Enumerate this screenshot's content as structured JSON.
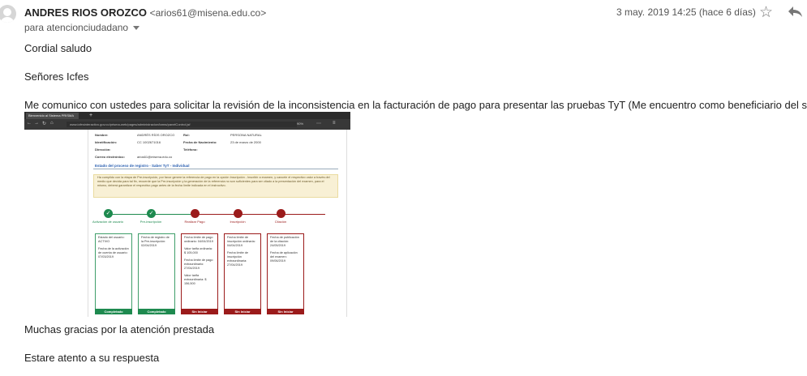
{
  "header": {
    "sender_name": "ANDRES RIOS OROZCO",
    "sender_email": "<arios61@misena.edu.co>",
    "to_line": "para atencionciudadano",
    "date": "3 may. 2019 14:25 (hace 6 días)"
  },
  "body": {
    "greeting": "Cordial saludo",
    "salutation": "Señores Icfes",
    "paragraph": "Me comunico con ustedes para solicitar la revisión de la inconsistencia en la facturación de pago para presentar las pruebas TyT (Me encuentro como beneficiario del sena)",
    "thanks": "Muchas gracias por la atención prestada",
    "closing": "Estare atento a su respuesta"
  },
  "attachment": {
    "browser_tab": "Bienvenido al Sistema PRISMA",
    "url": "www.icfesinteractivo.gov.co/prisma-web/pages/administracion/tarea/panelControl.jsf",
    "zoom": "90%",
    "fields": [
      {
        "label": "Nombre:",
        "value": "ANDRÉS RÍOS OROZCO"
      },
      {
        "label": "Identificación:",
        "value": "CC 1002671016"
      },
      {
        "label": "Dirección:",
        "value": ""
      },
      {
        "label": "Correo electrónico:",
        "value": "arios61@misena.edu.co"
      }
    ],
    "fields_right": [
      {
        "label": "Rol:",
        "value": "PERSONA NATURAL"
      },
      {
        "label": "Fecha de Nacimiento:",
        "value": "23 de marzo de 2000"
      },
      {
        "label": "Teléfono:",
        "value": ""
      }
    ],
    "section_title": "Estado del proceso de registro - Saber TyT - Individual",
    "notice": "Ha cumplido con la etapa de Pre-inscripción, por favor genere la referencia de pago en la opción Inscripción - Inscribir a examen, y cancele el respectivo valor a través del medio que decida para tal fin, recuerde que la Pre-inscripción y la generación de la referencia no son suficientes para ser citado a la presentación del examen, para el mismo, deberá garantizar el respectivo pago antes de la fecha límite indicada en el instructivo.",
    "stages": [
      {
        "name": "Activación de usuario",
        "status": "Completado",
        "color": "#1e8a4f",
        "lines": [
          "Estado del usuario: ACTIVO",
          "Fecha de la activación de cuenta de usuario: 07/03/2019"
        ]
      },
      {
        "name": "Pre-inscripción",
        "status": "Completado",
        "color": "#1e8a4f",
        "lines": [
          "Fecha de registro de la Pre-inscripción: 02/04/2019"
        ]
      },
      {
        "name": "Realizar Pago",
        "status": "Sin Iniciar",
        "color": "#9b1b1b",
        "lines": [
          "Fecha límite de pago ordinario: 04/04/2019",
          "Valor tarifa ordinaria: $ 105,000",
          "Fecha límite de pago extraordinario: 27/04/2019",
          "Valor tarifa extraordinaria: $ 156,500"
        ]
      },
      {
        "name": "Inscripción",
        "status": "Sin Iniciar",
        "color": "#9b1b1b",
        "lines": [
          "Fecha límite de inscripción ordinaria: 04/04/2019",
          "Fecha límite de inscripción extraordinaria: 27/04/2019"
        ]
      },
      {
        "name": "Citación",
        "status": "Sin Iniciar",
        "color": "#9b1b1b",
        "lines": [
          "Fecha de publicación de la citación: 24/05/2019",
          "Fecha de aplicación del examen: 09/06/2019"
        ]
      }
    ]
  },
  "icons": {
    "star": "star-icon",
    "reply": "reply-icon",
    "avatar": "avatar-icon",
    "caret": "chevron-down-icon"
  },
  "colors": {
    "complete": "#1e8a4f",
    "pending": "#9b1b1b",
    "link": "#2a5fb0"
  }
}
